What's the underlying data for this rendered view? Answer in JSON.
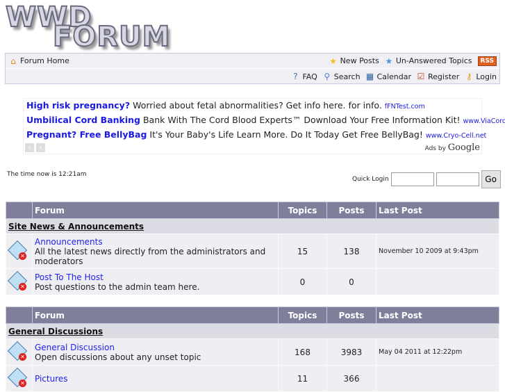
{
  "logo": {
    "line1": "WWD",
    "line2": "FORUM"
  },
  "nav": {
    "home": "Forum Home",
    "new_posts": "New Posts",
    "unanswered": "Un-Answered Topics",
    "rss": "RSS",
    "faq": "FAQ",
    "search": "Search",
    "calendar": "Calendar",
    "register": "Register",
    "login": "Login"
  },
  "ads": {
    "items": [
      {
        "title": "High risk pregnancy?",
        "text": "Worried about fetal abnormalities? Get info here. for info.",
        "url": "fFNTest.com"
      },
      {
        "title": "Umbilical Cord Banking",
        "text": "Bank With The Cord Blood Experts™ Download Your Free Information Kit!",
        "url": "www.ViaCord.co"
      },
      {
        "title": "Pregnant? Free BellyBag",
        "text": "It's Your Baby's Life Learn More. Do It Today Get Free BellyBag!",
        "url": "www.Cryo-Cell.net"
      }
    ],
    "ads_by": "Ads by",
    "google": "Google"
  },
  "time": "The time now is 12:21am",
  "quick_login": {
    "label": "Quick Login",
    "go": "Go"
  },
  "headers": {
    "forum": "Forum",
    "topics": "Topics",
    "posts": "Posts",
    "last_post": "Last Post"
  },
  "sections": [
    {
      "name": "Site News & Announcements",
      "forums": [
        {
          "name": "Announcements",
          "desc": "All the latest news directly from the administrators and moderators",
          "topics": "15",
          "posts": "138",
          "last_post": "November 10 2009 at 9:43pm"
        },
        {
          "name": "Post To The Host",
          "desc": "Post questions to the admin team here.",
          "topics": "0",
          "posts": "0",
          "last_post": ""
        }
      ]
    },
    {
      "name": "General Discussions",
      "forums": [
        {
          "name": "General Discussion",
          "desc": "Open discussions about any unset topic",
          "topics": "168",
          "posts": "3983",
          "last_post": "May 04 2011 at 12:22pm"
        },
        {
          "name": "Pictures",
          "desc": "",
          "topics": "11",
          "posts": "366",
          "last_post": ""
        }
      ]
    }
  ]
}
